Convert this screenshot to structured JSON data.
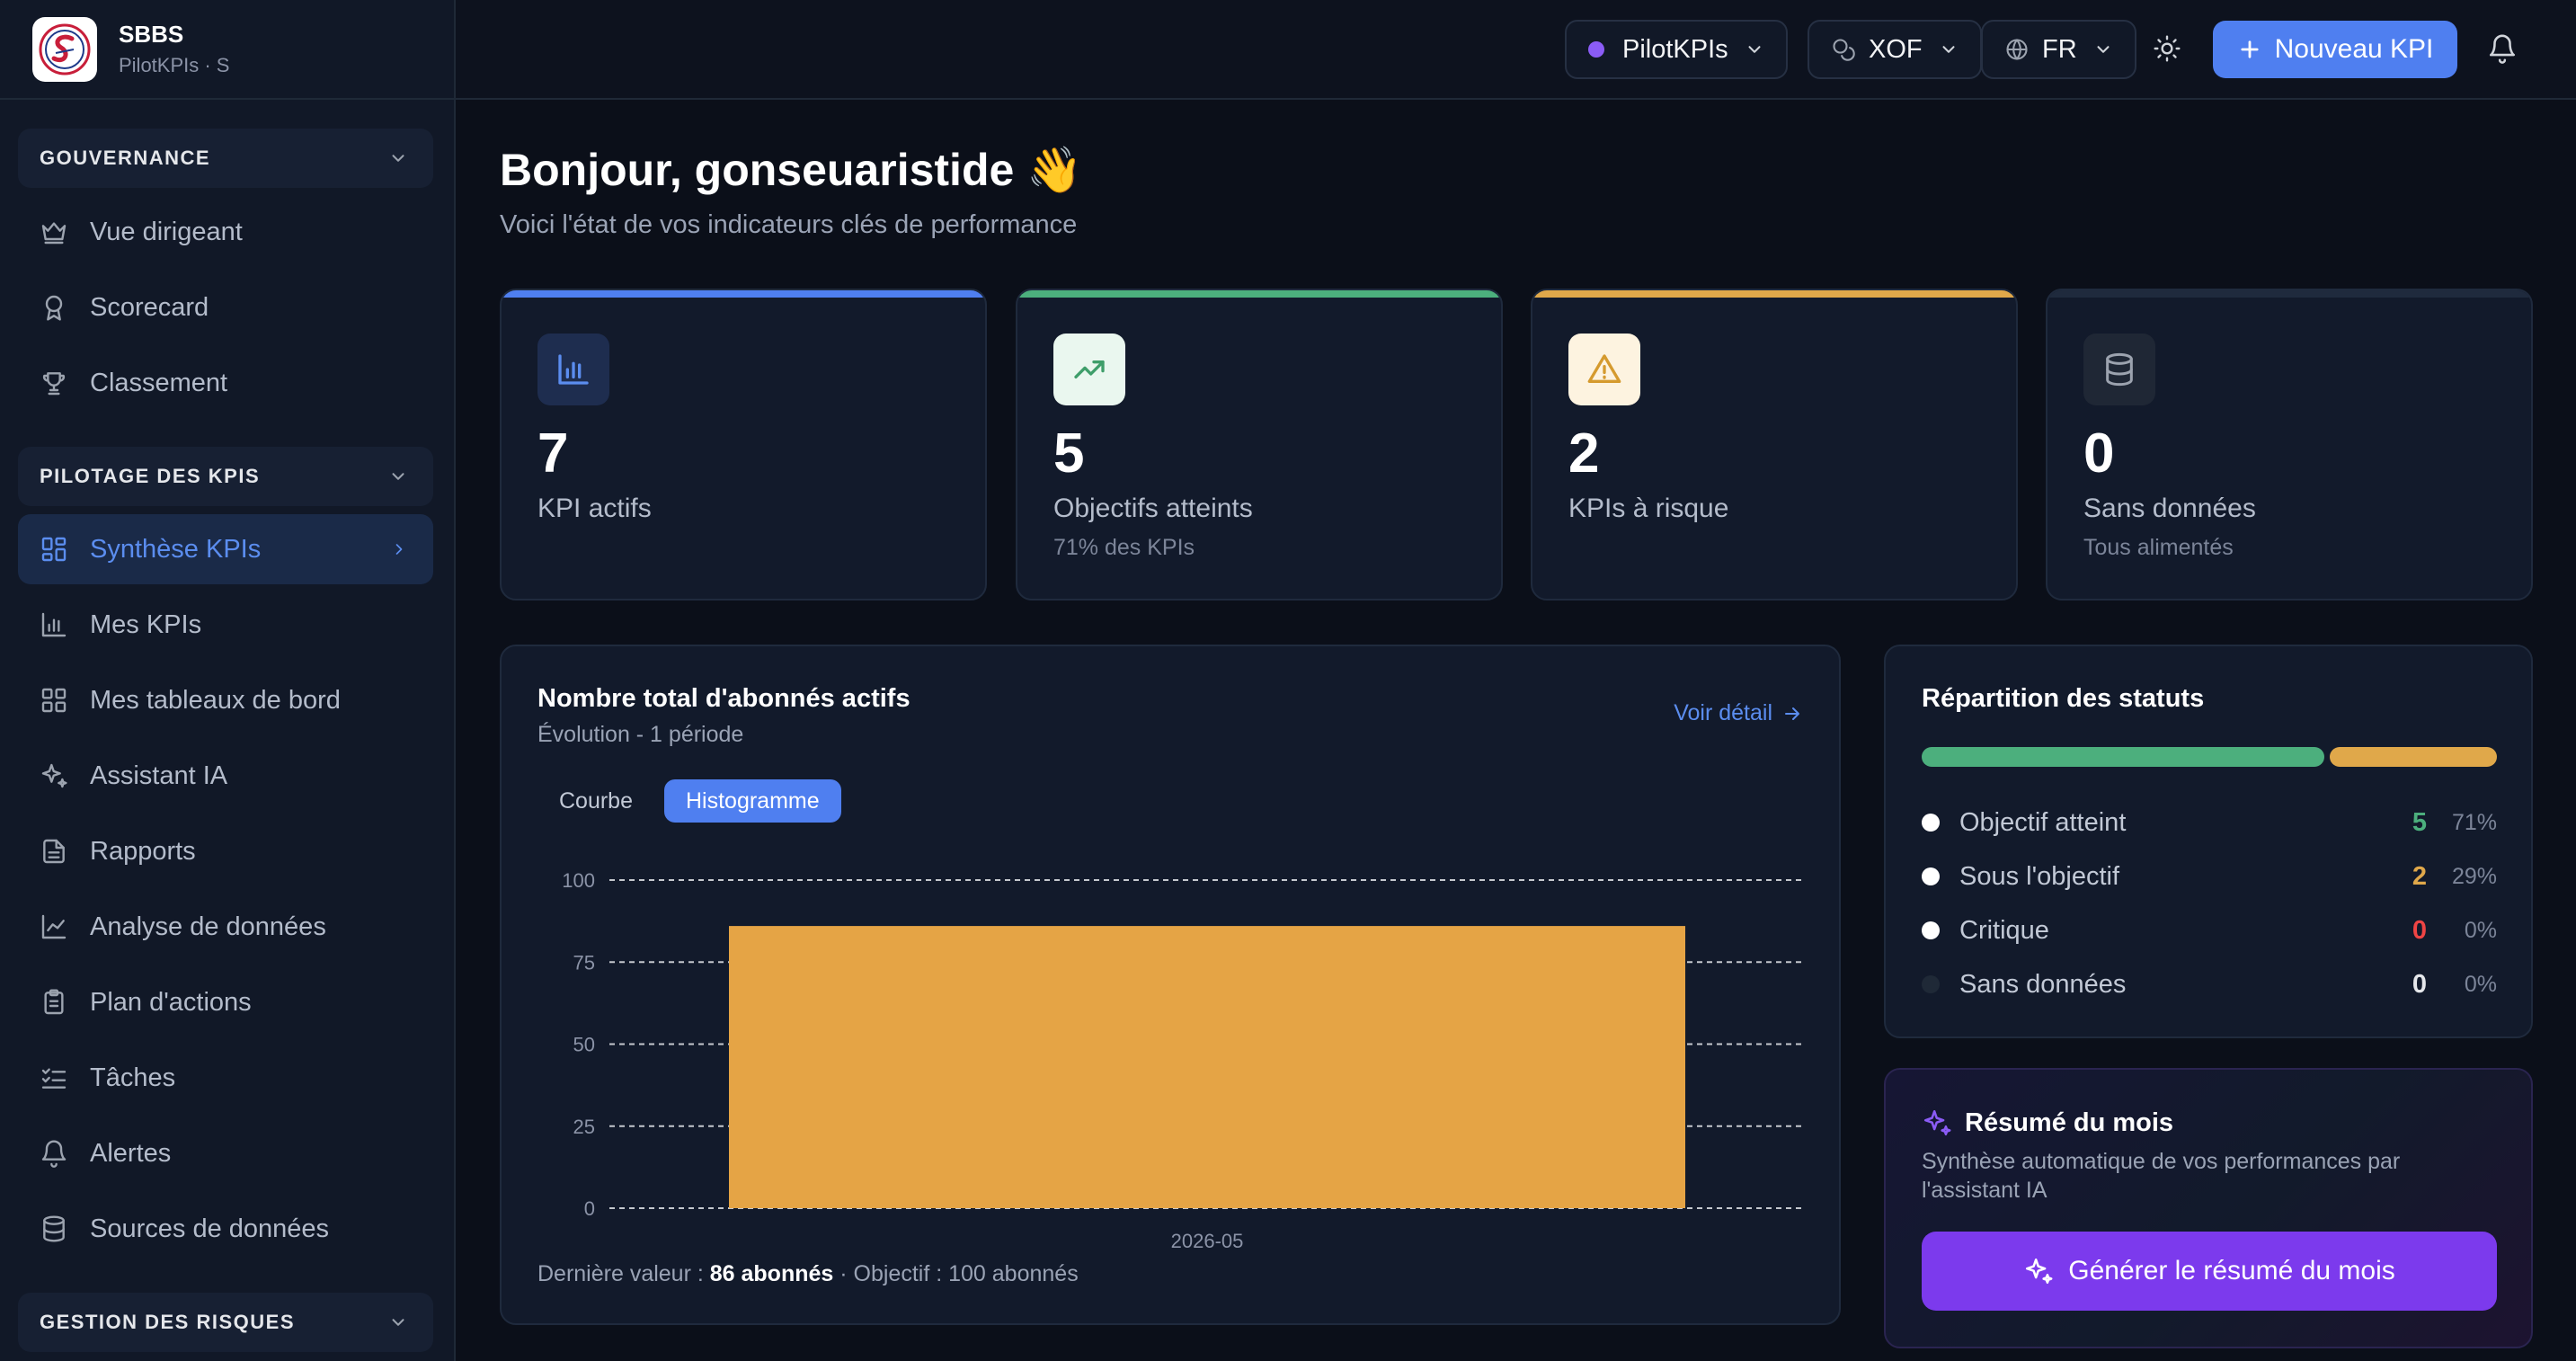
{
  "brand": {
    "name": "SBBS",
    "subtitle": "PilotKPIs · S",
    "logo": "sbbs-logo"
  },
  "topbar": {
    "workspace": "PilotKPIs",
    "currency": "XOF",
    "language": "FR",
    "new_kpi_label": "Nouveau KPI",
    "icons": [
      "chevron-down-icon",
      "coins-icon",
      "globe-icon",
      "sun-icon",
      "plus-icon",
      "bell-icon"
    ]
  },
  "sidebar": {
    "groups": [
      {
        "label": "GOUVERNANCE",
        "items": [
          {
            "label": "Vue dirigeant",
            "icon": "crown-icon"
          },
          {
            "label": "Scorecard",
            "icon": "award-icon"
          },
          {
            "label": "Classement",
            "icon": "trophy-icon"
          }
        ]
      },
      {
        "label": "PILOTAGE DES KPIS",
        "items": [
          {
            "label": "Synthèse KPIs",
            "icon": "layout-grid-icon",
            "active": true
          },
          {
            "label": "Mes KPIs",
            "icon": "bar-chart-icon"
          },
          {
            "label": "Mes tableaux de bord",
            "icon": "dashboard-icon"
          },
          {
            "label": "Assistant IA",
            "icon": "sparkles-icon"
          },
          {
            "label": "Rapports",
            "icon": "file-text-icon"
          },
          {
            "label": "Analyse de données",
            "icon": "line-chart-icon"
          },
          {
            "label": "Plan d'actions",
            "icon": "clipboard-icon"
          },
          {
            "label": "Tâches",
            "icon": "list-checks-icon"
          },
          {
            "label": "Alertes",
            "icon": "bell-icon"
          },
          {
            "label": "Sources de données",
            "icon": "database-icon"
          }
        ]
      },
      {
        "label": "GESTION DES RISQUES",
        "items": []
      }
    ]
  },
  "main": {
    "greeting": "Bonjour, gonseuaristide 👋",
    "subtitle": "Voici l'état de vos indicateurs clés de performance",
    "stats": [
      {
        "value": "7",
        "label": "KPI actifs",
        "sub": "",
        "accent": "#4f7ff0",
        "icon": "bar-chart-icon"
      },
      {
        "value": "5",
        "label": "Objectifs atteints",
        "sub": "71% des KPIs",
        "accent": "#4caf7d",
        "icon": "trending-up-icon"
      },
      {
        "value": "2",
        "label": "KPIs à risque",
        "sub": "",
        "accent": "#e0a84a",
        "icon": "warning-icon"
      },
      {
        "value": "0",
        "label": "Sans données",
        "sub": "Tous alimentés",
        "accent": "#1f2a3d",
        "icon": "database-icon"
      }
    ],
    "chart_panel": {
      "title": "Nombre total d'abonnés actifs",
      "subtitle": "Évolution - 1 période",
      "detail_link": "Voir détail",
      "toggle_curve": "Courbe",
      "toggle_histogram": "Histogramme",
      "footer_prefix": "Dernière valeur : ",
      "footer_value": "86 abonnés",
      "footer_suffix": " · Objectif : 100 abonnés"
    },
    "status_panel": {
      "title": "Répartition des statuts",
      "rows": [
        {
          "name": "Objectif atteint",
          "count": "5",
          "pct": "71%",
          "color": "#4caf7d",
          "dot": "#ffffff"
        },
        {
          "name": "Sous l'objectif",
          "count": "2",
          "pct": "29%",
          "color": "#e0a84a",
          "dot": "#ffffff"
        },
        {
          "name": "Critique",
          "count": "0",
          "pct": "0%",
          "color": "#ef4444",
          "dot": "#ffffff"
        },
        {
          "name": "Sans données",
          "count": "0",
          "pct": "0%",
          "color": "#e5e7eb",
          "dot": "#1f2937"
        }
      ],
      "shares": [
        0.71,
        0.29
      ]
    },
    "summary_panel": {
      "title": "Résumé du mois",
      "subtitle": "Synthèse automatique de vos performances par l'assistant IA",
      "button": "Générer le résumé du mois"
    }
  },
  "chart_data": {
    "type": "bar",
    "categories": [
      "2026-05"
    ],
    "values": [
      86
    ],
    "series": [
      {
        "values": [
          86
        ],
        "color": "#e5a445"
      }
    ],
    "ylim": [
      0,
      100
    ],
    "yticks": [
      "0",
      "25",
      "50",
      "75",
      "100"
    ],
    "grid": true,
    "title": "Nombre total d'abonnés actifs"
  }
}
